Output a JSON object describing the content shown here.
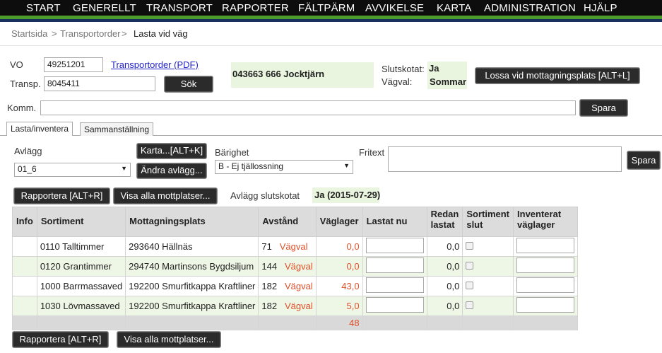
{
  "nav": [
    "START",
    "GENERELLT",
    "TRANSPORT",
    "RAPPORTER",
    "FÄLTPÄRM",
    "AVVIKELSE",
    "KARTA",
    "ADMINISTRATION",
    "HJÄLP"
  ],
  "breadcrumb": {
    "home": "Startsida",
    "sep1": ">",
    "parent": "Transportorder",
    "sep2": ">",
    "current": "Lasta vid väg"
  },
  "form": {
    "vo_label": "VO",
    "vo_value": "49251201",
    "transp_label": "Transp.",
    "transp_value": "8045411",
    "pdf_link": "Transportorder (PDF)",
    "search_button": "Sök",
    "info_box": "043663 666 Jocktjärn",
    "slutskotat_label": "Slutskotat:",
    "slutskotat_value": "Ja",
    "vagval_label": "Vägval:",
    "vagval_value": "Sommar",
    "unload_button": "Lossa vid mottagningsplats [ALT+L]",
    "komm_label": "Komm.",
    "komm_value": "",
    "save_button": "Spara"
  },
  "tabs": [
    "Lasta/inventera",
    "Sammanställning"
  ],
  "panel": {
    "avlagg_label": "Avlägg",
    "avlagg_value": "01_6",
    "karta_button": "Karta...[ALT+K]",
    "andra_button": "Ändra avlägg...",
    "barighet_label": "Bärighet",
    "barighet_value": "B - Ej tjällossning",
    "fritext_label": "Fritext",
    "spara_button": "Spara",
    "report_button": "Rapportera [ALT+R]",
    "show_button": "Visa alla mottplatser...",
    "avlagg_slutskotat_label": "Avlägg slutskotat",
    "avlagg_slutskotat_value": "Ja (2015-07-29)"
  },
  "table": {
    "headers": [
      "Info",
      "Sortiment",
      "Mottagningsplats",
      "Avstånd",
      "Väglager",
      "Lastat nu",
      "Redan lastat",
      "Sortiment slut",
      "Inventerat väglager"
    ],
    "rows": [
      {
        "sortiment": "0110 Talltimmer",
        "mottagningsplats": "293640 Hällnäs",
        "avstand": "71",
        "vagval": "Vägval",
        "vaglager": "0,0",
        "redan": "0,0"
      },
      {
        "sortiment": "0120 Grantimmer",
        "mottagningsplats": "294740 Martinsons Bygdsiljum",
        "avstand": "144",
        "vagval": "Vägval",
        "vaglager": "0,0",
        "redan": "0,0"
      },
      {
        "sortiment": "1000 Barrmassaved",
        "mottagningsplats": "192200 Smurfitkappa Kraftliner",
        "avstand": "182",
        "vagval": "Vägval",
        "vaglager": "43,0",
        "redan": "0,0"
      },
      {
        "sortiment": "1030 Lövmassaved",
        "mottagningsplats": "192200 Smurfitkappa Kraftliner",
        "avstand": "182",
        "vagval": "Vägval",
        "vaglager": "5,0",
        "redan": "0,0"
      }
    ],
    "total": "48"
  },
  "bottom": {
    "report_button": "Rapportera [ALT+R]",
    "show_button": "Visa alla mottplatser..."
  }
}
